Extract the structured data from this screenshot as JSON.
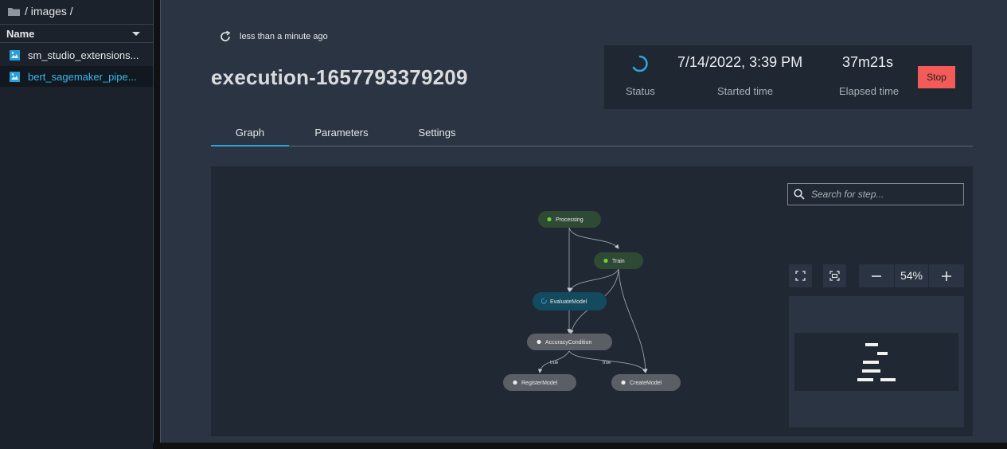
{
  "sidebar": {
    "breadcrumb": "/ images /",
    "column_header": "Name",
    "files": [
      {
        "name": "sm_studio_extensions..."
      },
      {
        "name": "bert_sagemaker_pipe..."
      }
    ]
  },
  "execution": {
    "refresh_text": "less than a minute ago",
    "title": "execution-1657793379209",
    "status_label": "Status",
    "started_value": "7/14/2022, 3:39 PM",
    "started_label": "Started time",
    "elapsed_value": "37m21s",
    "elapsed_label": "Elapsed time",
    "stop_label": "Stop"
  },
  "tabs": [
    {
      "label": "Graph"
    },
    {
      "label": "Parameters"
    },
    {
      "label": "Settings"
    }
  ],
  "graph": {
    "search_placeholder": "Search for step...",
    "zoom": "54%",
    "nodes": [
      {
        "label": "Processing",
        "status": "succeeded"
      },
      {
        "label": "Train",
        "status": "succeeded"
      },
      {
        "label": "EvaluateModel",
        "status": "executing"
      },
      {
        "label": "AccuracyCondition",
        "status": "not-started"
      },
      {
        "label": "RegisterModel",
        "status": "not-started"
      },
      {
        "label": "CreateModel",
        "status": "not-started"
      }
    ],
    "edge_labels": [
      "true",
      "true"
    ]
  },
  "colors": {
    "succeeded_node": "#2f4a34",
    "succeeded_dot": "#6dd13a",
    "executing_node": "#144a5e",
    "pending_node": "#5a5f66",
    "accent": "#2fa4d8",
    "stop": "#f25b57"
  }
}
